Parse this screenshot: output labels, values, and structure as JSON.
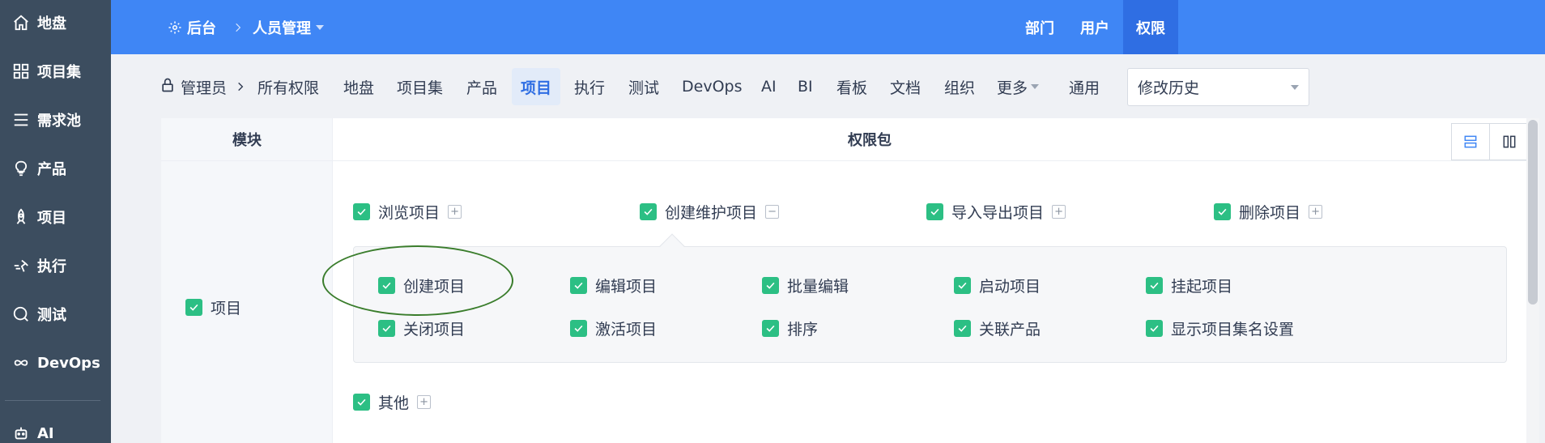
{
  "sidebar": {
    "items": [
      {
        "label": "地盘",
        "icon": "home-icon"
      },
      {
        "label": "项目集",
        "icon": "grid-icon"
      },
      {
        "label": "需求池",
        "icon": "list-icon"
      },
      {
        "label": "产品",
        "icon": "bulb-icon"
      },
      {
        "label": "项目",
        "icon": "rocket-icon"
      },
      {
        "label": "执行",
        "icon": "run-icon"
      },
      {
        "label": "测试",
        "icon": "search-circle-icon"
      },
      {
        "label": "DevOps",
        "icon": "infinity-icon"
      },
      {
        "label": "AI",
        "icon": "robot-icon"
      }
    ]
  },
  "header": {
    "back_label": "后台",
    "menu_label": "人员管理",
    "nav": [
      {
        "label": "部门",
        "active": false
      },
      {
        "label": "用户",
        "active": false
      },
      {
        "label": "权限",
        "active": true
      }
    ],
    "accent": "#3f86f5"
  },
  "subnav": {
    "role_label": "管理员",
    "items": [
      "所有权限",
      "地盘",
      "项目集",
      "产品",
      "项目",
      "执行",
      "测试",
      "DevOps",
      "AI",
      "BI",
      "看板",
      "文档",
      "组织",
      "更多",
      "通用"
    ],
    "active": "项目",
    "history_select": "修改历史"
  },
  "table": {
    "col_module": "模块",
    "col_package": "权限包",
    "module_label": "项目",
    "packages": [
      {
        "label": "浏览项目",
        "toggle": "+"
      },
      {
        "label": "创建维护项目",
        "toggle": "−"
      },
      {
        "label": "导入导出项目",
        "toggle": "+"
      },
      {
        "label": "删除项目",
        "toggle": "+"
      }
    ],
    "permissions_row1": [
      "创建项目",
      "编辑项目",
      "批量编辑",
      "启动项目",
      "挂起项目"
    ],
    "permissions_row2": [
      "关闭项目",
      "激活项目",
      "排序",
      "关联产品",
      "显示项目集名设置"
    ],
    "other_label": "其他",
    "other_toggle": "+",
    "check_color": "#2cbf84"
  }
}
